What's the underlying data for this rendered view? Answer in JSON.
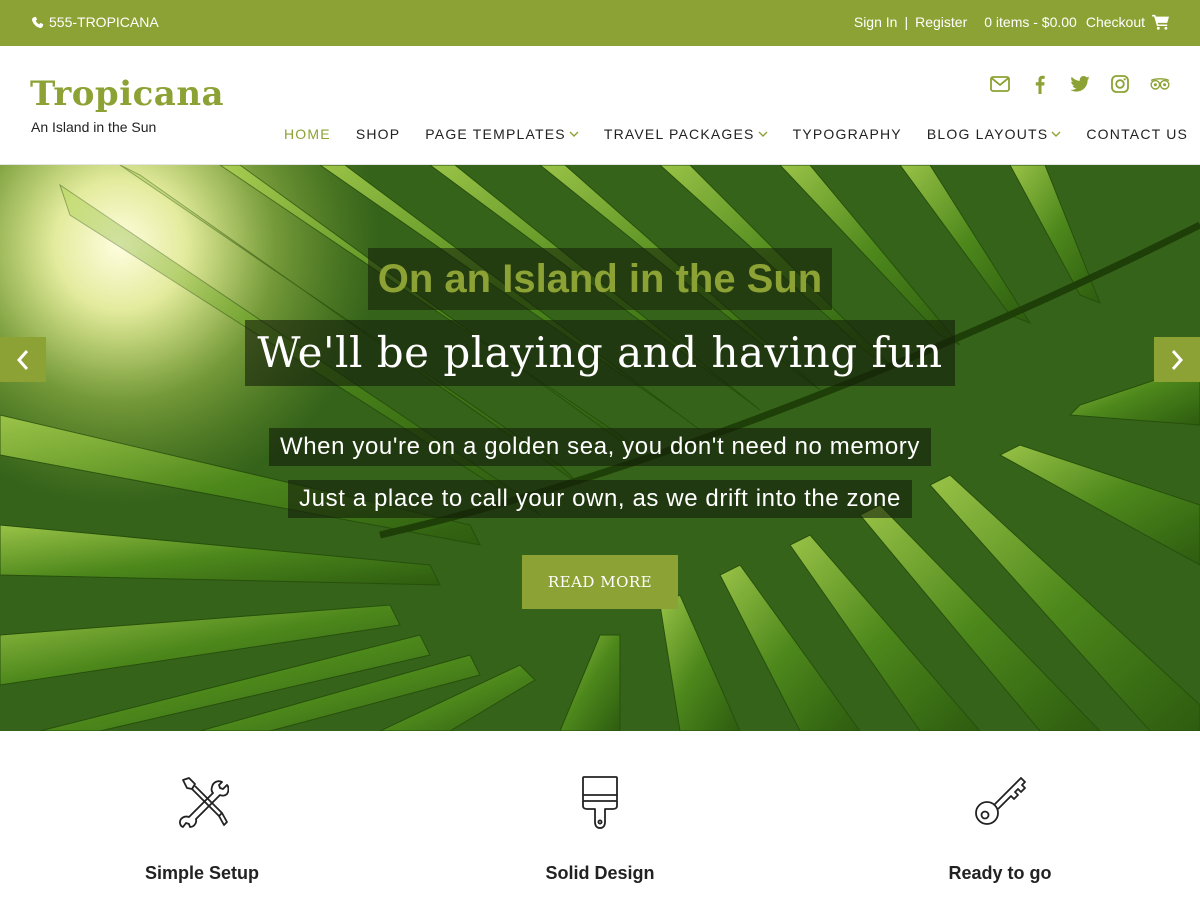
{
  "topbar": {
    "phone": "555-TROPICANA",
    "sign_in": "Sign In",
    "separator": "|",
    "register": "Register",
    "cart_summary": "0 items - $0.00",
    "checkout": "Checkout"
  },
  "header": {
    "site_title": "Tropicana",
    "tagline": "An Island in the Sun",
    "social": [
      "envelope-icon",
      "facebook-icon",
      "twitter-icon",
      "instagram-icon",
      "tripadvisor-icon"
    ],
    "nav": [
      {
        "label": "HOME",
        "active": true
      },
      {
        "label": "SHOP"
      },
      {
        "label": "PAGE TEMPLATES",
        "dropdown": true
      },
      {
        "label": "TRAVEL PACKAGES",
        "dropdown": true
      },
      {
        "label": "TYPOGRAPHY"
      },
      {
        "label": "BLOG LAYOUTS",
        "dropdown": true
      },
      {
        "label": "CONTACT US"
      }
    ]
  },
  "hero": {
    "title": "On an Island in the Sun",
    "subtitle": "We'll be playing and having fun",
    "line1": "When you're on a golden sea, you don't need no memory",
    "line2": "Just a place to call your own, as we drift into the zone",
    "button": "READ MORE"
  },
  "features": [
    {
      "icon": "tools-icon",
      "title": "Simple Setup"
    },
    {
      "icon": "paintbrush-icon",
      "title": "Solid Design"
    },
    {
      "icon": "key-icon",
      "title": "Ready to go"
    }
  ],
  "colors": {
    "accent": "#8ca234",
    "text": "#222222"
  }
}
